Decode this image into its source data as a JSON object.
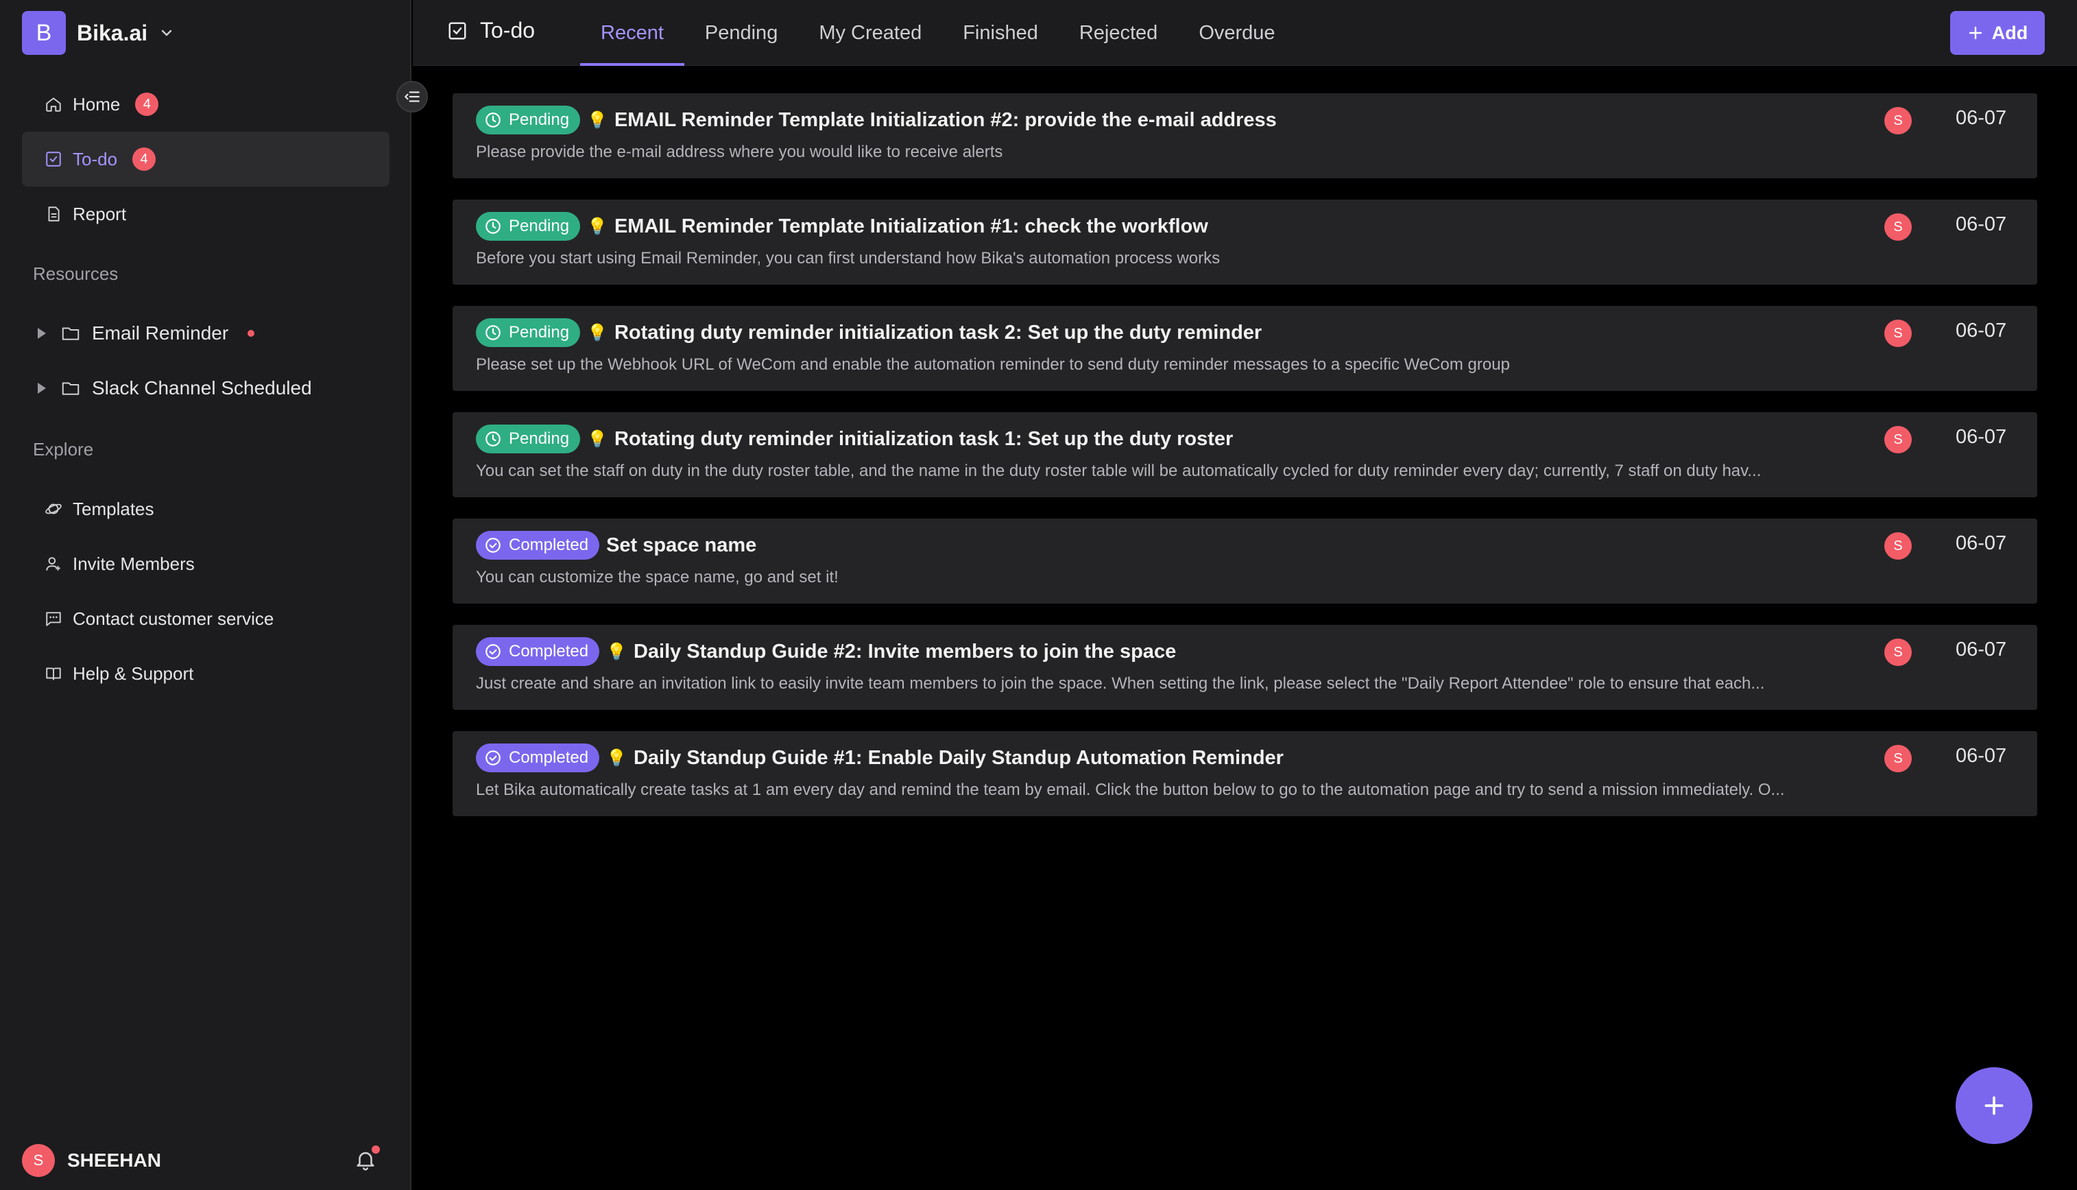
{
  "brand": {
    "logo_letter": "B",
    "name": "Bika.ai"
  },
  "sidebar": {
    "nav": [
      {
        "label": "Home",
        "badge": "4"
      },
      {
        "label": "To-do",
        "badge": "4"
      },
      {
        "label": "Report"
      }
    ],
    "resources_title": "Resources",
    "resources": [
      {
        "label": "Email Reminder"
      },
      {
        "label": "Slack Channel Scheduled"
      }
    ],
    "explore_title": "Explore",
    "explore": [
      {
        "label": "Templates"
      },
      {
        "label": "Invite Members"
      },
      {
        "label": "Contact customer service"
      },
      {
        "label": "Help & Support"
      }
    ],
    "user": {
      "avatar_letter": "S",
      "name": "SHEEHAN"
    }
  },
  "header": {
    "title": "To-do",
    "tabs": [
      "Recent",
      "Pending",
      "My Created",
      "Finished",
      "Rejected",
      "Overdue"
    ],
    "add_label": "Add"
  },
  "colors": {
    "accent": "#7b67ee",
    "pending": "#2fae83",
    "badge": "#f25c67"
  },
  "todos": [
    {
      "status": "Pending",
      "title": "EMAIL Reminder Template Initialization #2: provide the e-mail address",
      "desc": "Please provide the e-mail address where you would like to receive alerts",
      "avatar": "S",
      "date": "06-07"
    },
    {
      "status": "Pending",
      "title": "EMAIL Reminder Template Initialization #1: check the workflow",
      "desc": "Before you start using Email Reminder, you can first understand how Bika's automation process works",
      "avatar": "S",
      "date": "06-07"
    },
    {
      "status": "Pending",
      "title": "Rotating duty reminder initialization task 2: Set up the duty reminder",
      "desc": "Please set up the Webhook URL of WeCom and enable the automation reminder to send duty reminder messages to a specific WeCom group",
      "avatar": "S",
      "date": "06-07"
    },
    {
      "status": "Pending",
      "title": "Rotating duty reminder initialization task 1: Set up the duty roster",
      "desc": "You can set the staff on duty in the duty roster table, and the name in the duty roster table will be automatically cycled for duty reminder every day; currently, 7 staff on duty hav...",
      "avatar": "S",
      "date": "06-07"
    },
    {
      "status": "Completed",
      "title": "Set space name",
      "desc": "You can customize the space name, go and set it!",
      "avatar": "S",
      "date": "06-07"
    },
    {
      "status": "Completed",
      "title": "Daily Standup Guide #2: Invite members to join the space",
      "desc": "Just create and share an invitation link to easily invite team members to join the space. When setting the link, please select the \"Daily Report Attendee\" role to ensure that each...",
      "avatar": "S",
      "date": "06-07"
    },
    {
      "status": "Completed",
      "title": "Daily Standup Guide #1: Enable Daily Standup Automation Reminder",
      "desc": "Let Bika automatically create tasks at 1 am every day and remind the team by email. Click the button below to go to the automation page and try to send a mission immediately. O...",
      "avatar": "S",
      "date": "06-07"
    }
  ]
}
